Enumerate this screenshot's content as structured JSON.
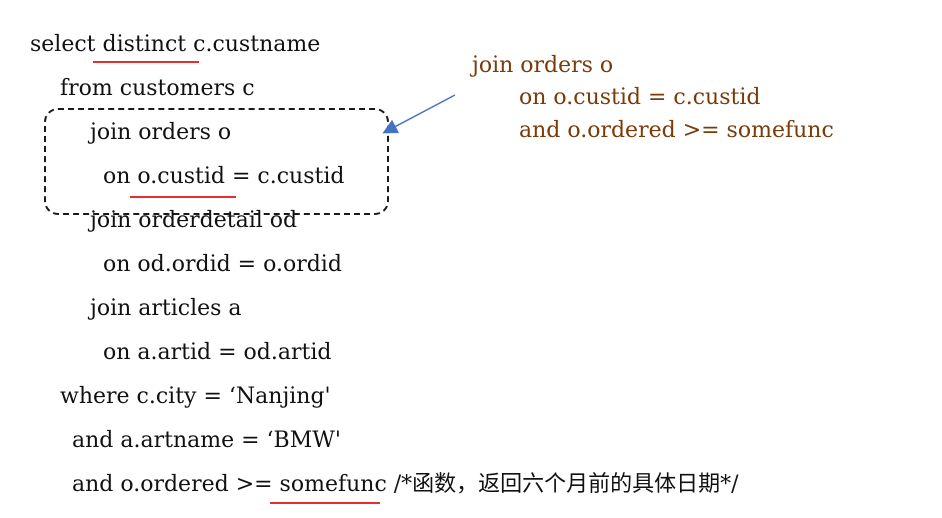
{
  "sql": {
    "lines": [
      "select distinct  c.custname",
      "from customers c",
      "join orders o",
      "on o.custid = c.custid",
      "join orderdetail od",
      "on od.ordid = o.ordid",
      "join articles a",
      "on a.artid = od.artid",
      "where c.city = ‘Nanjing'",
      "and a.artname = ‘BMW'",
      "and o.ordered >= somefunc /*函数，返回六个月前的具体日期*/"
    ]
  },
  "annotation": {
    "lines": [
      "join orders o",
      "on o.custid = c.custid",
      "and o.ordered >= somefunc"
    ]
  },
  "colors": {
    "code_text": "#111111",
    "annotation_text": "#7a3b0a",
    "underline": "#e23030",
    "arrow": "#4472c4",
    "dashed_box": "#1a1a1a"
  }
}
